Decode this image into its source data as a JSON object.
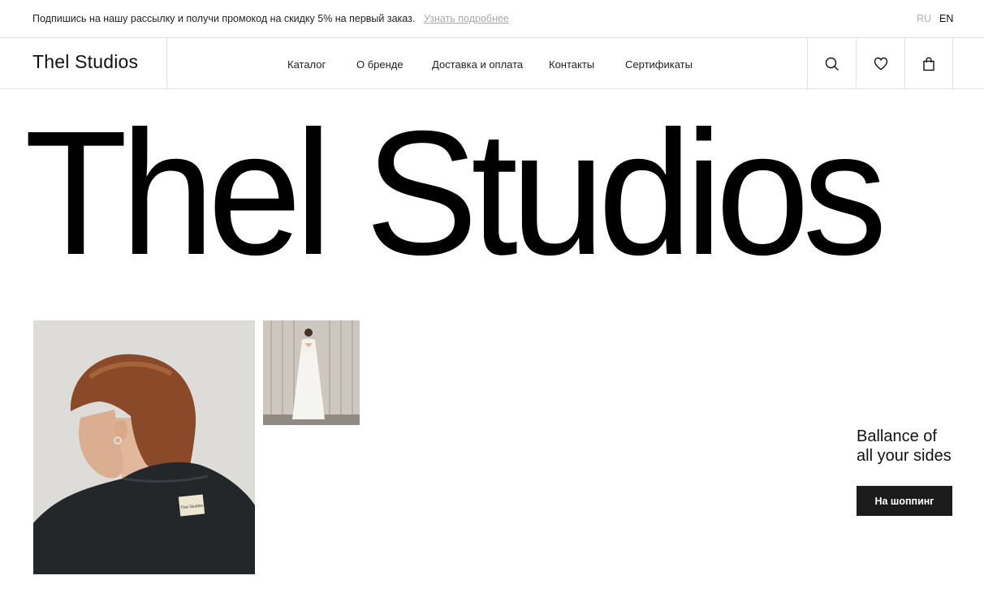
{
  "promo": {
    "text": "Подпишись на нашу рассылку и получи промокод на скидку 5% на первый заказ.",
    "link": "Узнать подробнее"
  },
  "languages": {
    "ru": "RU",
    "en": "EN",
    "active": "EN"
  },
  "header": {
    "logo": "Thel Studios",
    "nav": [
      "Каталог",
      "О бренде",
      "Доставка и оплата",
      "Контакты",
      "Сертификаты"
    ],
    "icons": [
      "search-icon",
      "heart-icon",
      "bag-icon"
    ]
  },
  "hero": {
    "title": "Thel Studios",
    "tagline": "Ballance of\nall your sides",
    "cta": "На шоппинг"
  },
  "images": {
    "main": "woman-back-jacket-photo",
    "secondary": "white-dress-photo",
    "jacket_label": "Thel Studios"
  },
  "colors": {
    "text": "#111111",
    "muted": "#a8a8a8",
    "border": "#e2e2e2",
    "button": "#1b1b1b"
  }
}
